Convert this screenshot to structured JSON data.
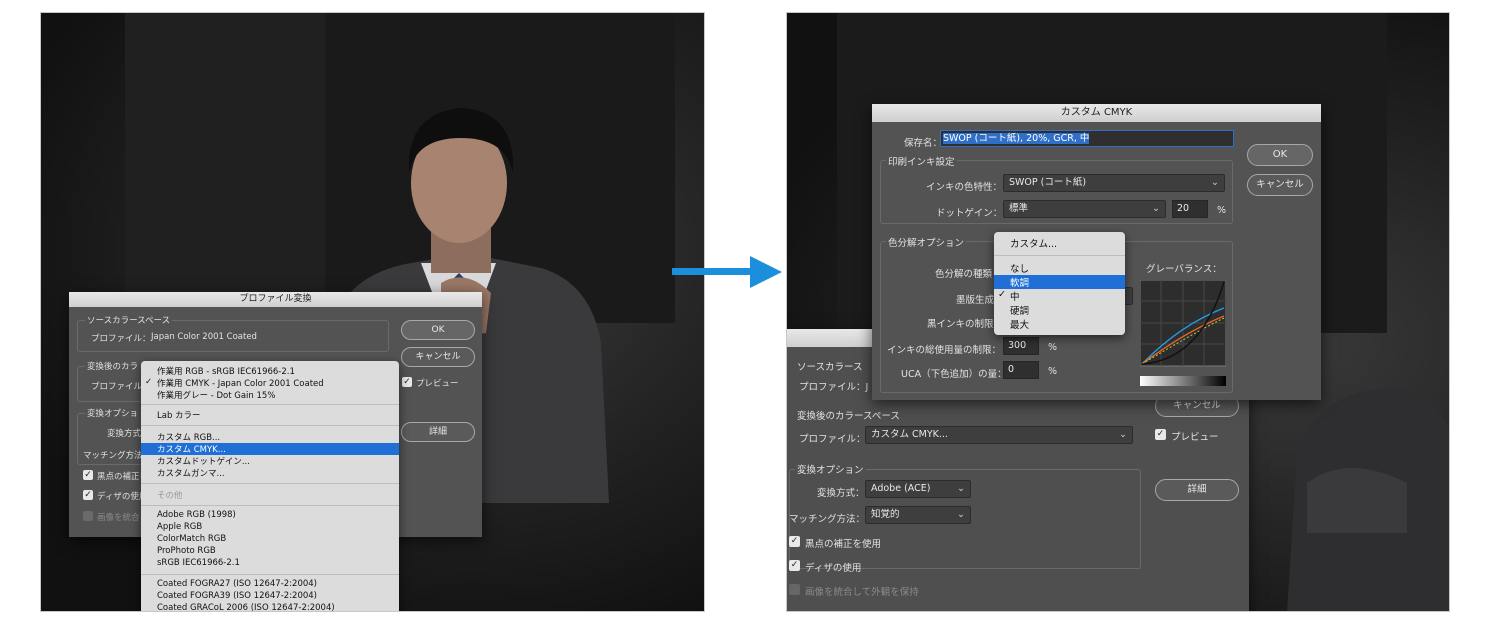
{
  "left": {
    "dialog_title": "プロファイル変換",
    "source": {
      "group": "ソースカラースペース",
      "profile_label": "プロファイル：",
      "profile_value": "Japan Color 2001 Coated"
    },
    "dest": {
      "group": "変換後のカラ",
      "profile_label": "プロファイル"
    },
    "options": {
      "group": "変換オプショ",
      "method_label": "変換方式",
      "intent_label": "マッチング方法"
    },
    "checks": [
      {
        "label": "黒点の補正を",
        "checked": true
      },
      {
        "label": "ディザの使用",
        "checked": true
      },
      {
        "label": "画像を統合し",
        "checked": false
      }
    ],
    "buttons": {
      "ok": "OK",
      "cancel": "キャンセル",
      "advanced": "詳細",
      "preview": "プレビュー"
    },
    "menu": {
      "check": "✓",
      "group1": [
        "作業用 RGB - sRGB IEC61966-2.1",
        "作業用 CMYK - Japan Color 2001 Coated",
        "作業用グレー - Dot Gain 15%"
      ],
      "group2": [
        "Lab カラー"
      ],
      "group3": [
        "カスタム RGB...",
        "カスタム CMYK...",
        "カスタムドットゲイン...",
        "カスタムガンマ..."
      ],
      "other": "その他",
      "group4": [
        "Adobe RGB (1998)",
        "Apple RGB",
        "ColorMatch RGB",
        "ProPhoto RGB",
        "sRGB IEC61966-2.1"
      ],
      "group5": [
        "Coated FOGRA27 (ISO 12647-2:2004)",
        "Coated FOGRA39 (ISO 12647-2:2004)",
        "Coated GRACoL 2006 (ISO 12647-2:2004)"
      ]
    }
  },
  "arrow_color": "#1c8fdc",
  "right": {
    "dialog_title": "カスタム CMYK",
    "name_label": "保存名：",
    "name_value": "SWOP (コート紙), 20%, GCR, 中",
    "ink": {
      "group": "印刷インキ設定",
      "colors_label": "インキの色特性：",
      "colors_value": "SWOP (コート紙)",
      "gain_label": "ドットゲイン：",
      "gain_value": "標準",
      "gain_pct": "20",
      "pct": "%"
    },
    "sep": {
      "group": "色分解オプション",
      "type_label": "色分解の種類",
      "black_label": "墨版生成",
      "limit_label": "黒インキの制限",
      "total_label": "インキの総使用量の制限：",
      "total_value": "300",
      "uca_label": "UCA（下色追加）の量：",
      "uca_value": "0",
      "pct": "%",
      "gray_balance": "グレーバランス："
    },
    "buttons": {
      "ok": "OK",
      "cancel": "キャンセル"
    },
    "menu": {
      "custom": "カスタム...",
      "items": [
        "なし",
        "軟調",
        "中",
        "硬調",
        "最大"
      ],
      "highlighted": "軟調",
      "check": "✓"
    },
    "behind": {
      "source_group": "ソースカラース",
      "source_profile_label": "プロファイル：J",
      "dest_group": "変換後のカラースペース",
      "dest_profile_label": "プロファイル：",
      "dest_profile_value": "カスタム CMYK...",
      "options_group": "変換オプション",
      "method_label": "変換方式：",
      "method_value": "Adobe (ACE)",
      "intent_label": "マッチング方法：",
      "intent_value": "知覚的",
      "checks": [
        {
          "label": "黒点の補正を使用",
          "checked": true
        },
        {
          "label": "ディザの使用",
          "checked": true
        },
        {
          "label": "画像を統合して外観を保持",
          "checked": false
        }
      ],
      "cancel": "キャンセル",
      "preview": "プレビュー",
      "advanced": "詳細"
    }
  }
}
